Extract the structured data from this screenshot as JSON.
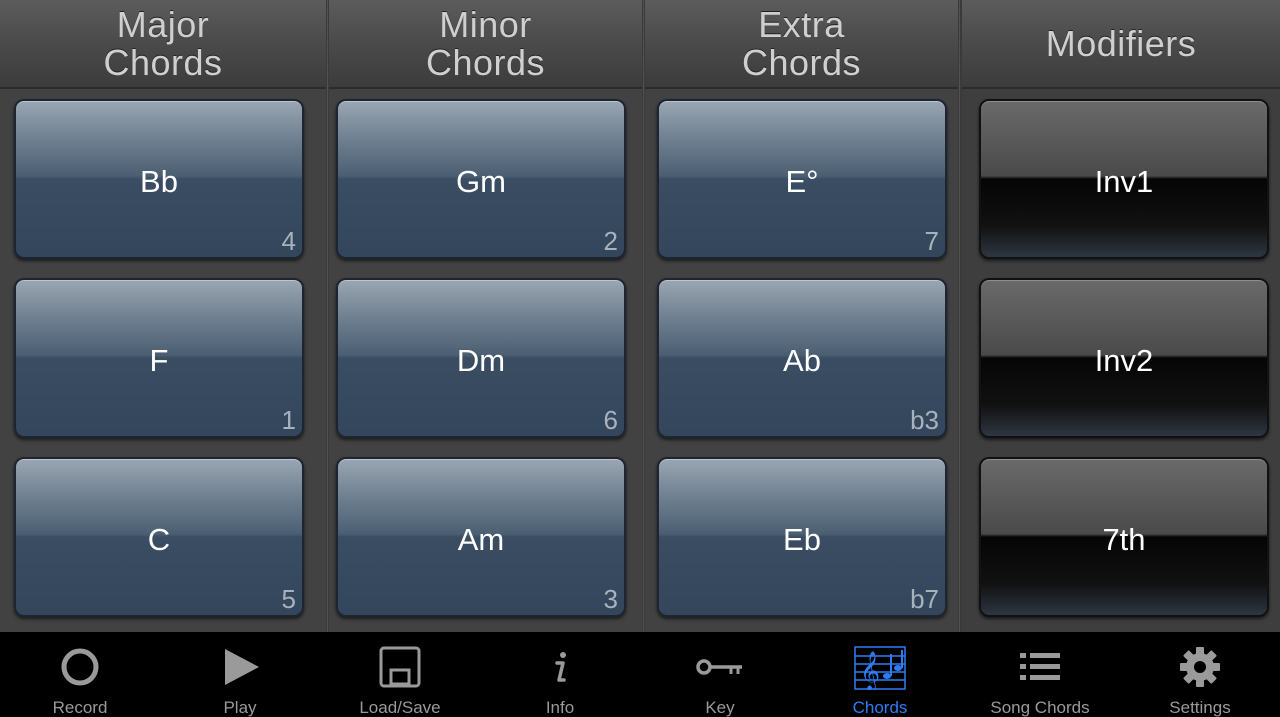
{
  "columns": [
    {
      "title": "Major\nChords",
      "buttons": [
        {
          "name": "Bb",
          "hint": "4"
        },
        {
          "name": "F",
          "hint": "1"
        },
        {
          "name": "C",
          "hint": "5"
        }
      ]
    },
    {
      "title": "Minor\nChords",
      "buttons": [
        {
          "name": "Gm",
          "hint": "2"
        },
        {
          "name": "Dm",
          "hint": "6"
        },
        {
          "name": "Am",
          "hint": "3"
        }
      ]
    },
    {
      "title": "Extra\nChords",
      "buttons": [
        {
          "name": "E°",
          "hint": "7"
        },
        {
          "name": "Ab",
          "hint": "b3"
        },
        {
          "name": "Eb",
          "hint": "b7"
        }
      ]
    },
    {
      "title": "Modifiers",
      "buttons": [
        {
          "name": "Inv1"
        },
        {
          "name": "Inv2"
        },
        {
          "name": "7th"
        }
      ]
    }
  ],
  "tabbar": {
    "active_color": "#2f7df6",
    "inactive_color": "#9a9a9a",
    "tabs": [
      {
        "label": "Record",
        "icon": "record-icon",
        "active": false
      },
      {
        "label": "Play",
        "icon": "play-icon",
        "active": false
      },
      {
        "label": "Load/Save",
        "icon": "save-icon",
        "active": false
      },
      {
        "label": "Info",
        "icon": "info-icon",
        "active": false
      },
      {
        "label": "Key",
        "icon": "key-icon",
        "active": false
      },
      {
        "label": "Chords",
        "icon": "music-staff-icon",
        "active": true
      },
      {
        "label": "Song Chords",
        "icon": "list-icon",
        "active": false
      },
      {
        "label": "Settings",
        "icon": "gear-icon",
        "active": false
      }
    ]
  }
}
